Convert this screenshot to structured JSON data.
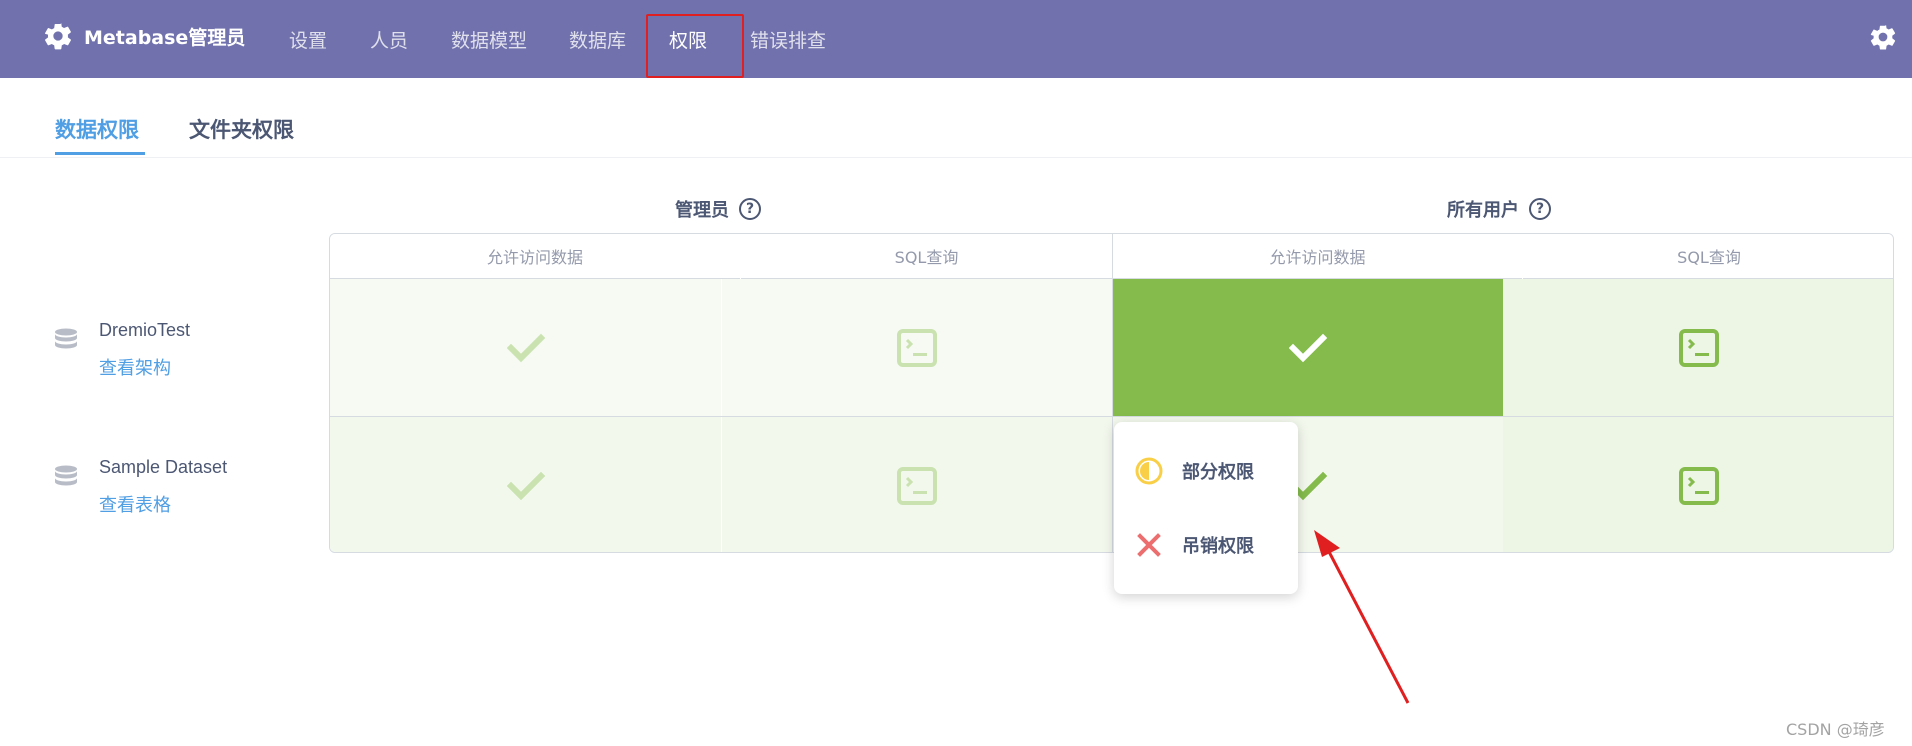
{
  "nav": {
    "brand": "Metabase管理员",
    "items": [
      "设置",
      "人员",
      "数据模型",
      "数据库",
      "权限",
      "错误排查"
    ],
    "active_index": 4
  },
  "tabs": {
    "items": [
      "数据权限",
      "文件夹权限"
    ],
    "active_index": 0
  },
  "groups": [
    {
      "name": "管理员",
      "columns": [
        "允许访问数据",
        "SQL查询"
      ]
    },
    {
      "name": "所有用户",
      "columns": [
        "允许访问数据",
        "SQL查询"
      ]
    }
  ],
  "help_glyph": "?",
  "rows": [
    {
      "name": "DremioTest",
      "link": "查看架构"
    },
    {
      "name": "Sample Dataset",
      "link": "查看表格"
    }
  ],
  "popover": {
    "items": [
      {
        "label": "部分权限",
        "icon": "partial-icon"
      },
      {
        "label": "吊销权限",
        "icon": "close-icon"
      }
    ]
  },
  "colors": {
    "nav_bg": "#7172ad",
    "accent_blue": "#509ee3",
    "green_strong": "#84bb4c",
    "green_light": "#edf5e5",
    "green_faint": "#f3f8ed",
    "admin_cell": "#f6faf2",
    "arrow_red": "#e02020",
    "partial_yellow": "#f9cf48",
    "revoke_red": "#ed6e6e"
  },
  "watermark": "CSDN @琦彦"
}
